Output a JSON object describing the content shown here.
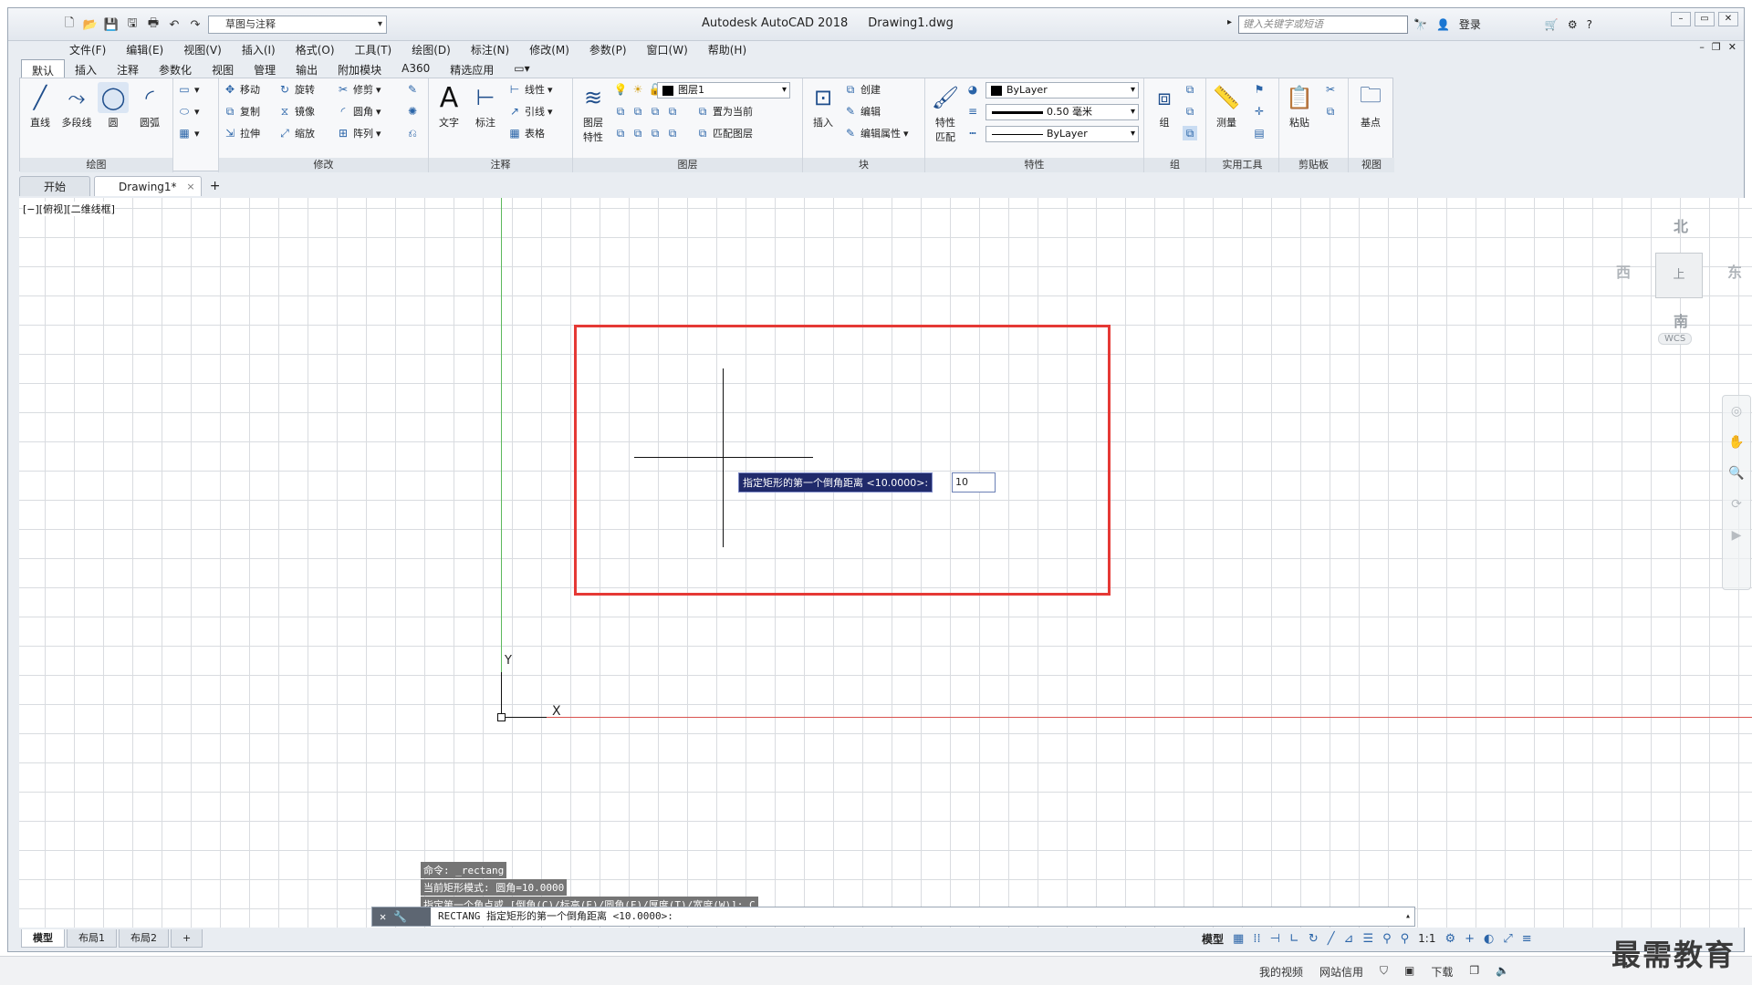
{
  "title": {
    "app": "Autodesk AutoCAD 2018",
    "file": "Drawing1.dwg"
  },
  "workspace": "草图与注释",
  "search_placeholder": "键入关键字或短语",
  "login": "登录",
  "menu": [
    "文件(F)",
    "编辑(E)",
    "视图(V)",
    "插入(I)",
    "格式(O)",
    "工具(T)",
    "绘图(D)",
    "标注(N)",
    "修改(M)",
    "参数(P)",
    "窗口(W)",
    "帮助(H)"
  ],
  "ribbon_tabs": [
    "默认",
    "插入",
    "注释",
    "参数化",
    "视图",
    "管理",
    "输出",
    "附加模块",
    "A360",
    "精选应用"
  ],
  "panels": {
    "draw": {
      "title": "绘图",
      "line": "直线",
      "polyline": "多段线",
      "circle": "圆",
      "arc": "圆弧"
    },
    "modify": {
      "title": "修改",
      "move": "移动",
      "rotate": "旋转",
      "trim": "修剪",
      "copy": "复制",
      "mirror": "镜像",
      "fillet": "圆角",
      "stretch": "拉伸",
      "scale": "缩放",
      "array": "阵列"
    },
    "annotation": {
      "title": "注释",
      "text": "文字",
      "dim": "标注",
      "linear": "线性",
      "leader": "引线",
      "table": "表格"
    },
    "layers": {
      "title": "图层",
      "props": "图层\n特性",
      "current": "图层1",
      "setcurrent": "置为当前",
      "match": "匹配图层"
    },
    "block": {
      "title": "块",
      "insert": "插入",
      "create": "创建",
      "edit": "编辑",
      "editattr": "编辑属性"
    },
    "properties": {
      "title": "特性",
      "match": "特性\n匹配",
      "color": "ByLayer",
      "lineweight": "0.50 毫米",
      "linetype": "ByLayer"
    },
    "groups": {
      "title": "组",
      "group": "组"
    },
    "utilities": {
      "title": "实用工具",
      "measure": "测量"
    },
    "clipboard": {
      "title": "剪贴板",
      "paste": "粘贴"
    },
    "view": {
      "title": "视图",
      "base": "基点"
    }
  },
  "doc_tabs": [
    "开始",
    "Drawing1*"
  ],
  "viewport_label": "[−][俯视][二维线框]",
  "viewcube": {
    "n": "北",
    "s": "南",
    "e": "东",
    "w": "西",
    "top": "上",
    "wcs": "WCS"
  },
  "ucs": {
    "x": "X",
    "y": "Y"
  },
  "dynamic_prompt": "指定矩形的第一个倒角距离 <10.0000>:",
  "dynamic_input": "10",
  "history": [
    "命令: _rectang",
    "当前矩形模式:  圆角=10.0000",
    "指定第一个角点或 [倒角(C)/标高(E)/圆角(F)/厚度(T)/宽度(W)]: C"
  ],
  "command_line": "RECTANG 指定矩形的第一个倒角距离 <10.0000>:",
  "layout_tabs": [
    "模型",
    "布局1",
    "布局2"
  ],
  "status": {
    "model": "模型",
    "scale": "1:1"
  },
  "taskbar": [
    "我的视频",
    "网站信用",
    "下载"
  ],
  "watermark": "最需教育"
}
